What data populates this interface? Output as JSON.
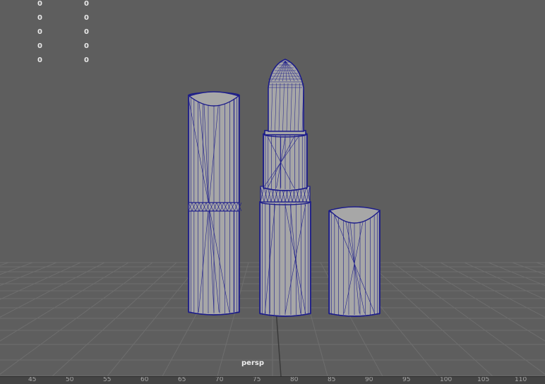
{
  "hud": {
    "rows": [
      {
        "col1": "0",
        "col2": "0"
      },
      {
        "col1": "0",
        "col2": "0"
      },
      {
        "col1": "0",
        "col2": "0"
      },
      {
        "col1": "0",
        "col2": "0"
      },
      {
        "col1": "0",
        "col2": "0"
      }
    ]
  },
  "viewport": {
    "camera_label": "persp",
    "background_color": "#5e5e5e",
    "grid_color": "#6e6e6e",
    "wireframe_color": "#1c1c8a",
    "shaded_color": "#a7a7a7"
  },
  "timeline": {
    "ticks": [
      "45",
      "50",
      "55",
      "60",
      "65",
      "70",
      "75",
      "80",
      "85",
      "90",
      "95",
      "100",
      "105",
      "110"
    ]
  }
}
